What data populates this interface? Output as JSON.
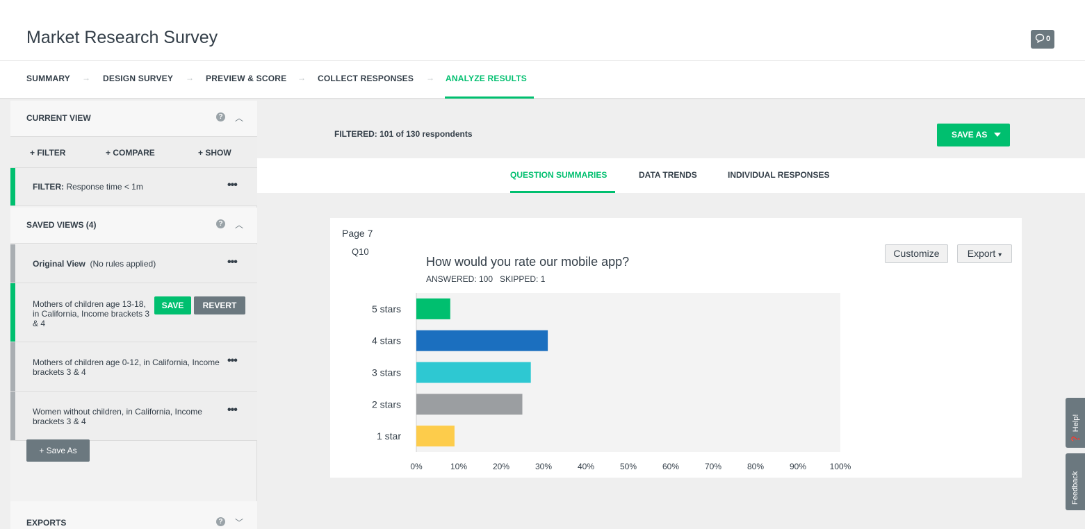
{
  "header": {
    "title": "Market Research Survey",
    "comment_count": "0"
  },
  "steps": [
    {
      "label": "SUMMARY"
    },
    {
      "label": "DESIGN SURVEY"
    },
    {
      "label": "PREVIEW & SCORE"
    },
    {
      "label": "COLLECT RESPONSES"
    },
    {
      "label": "ANALYZE RESULTS"
    }
  ],
  "sidebar": {
    "current_view": {
      "heading": "CURRENT VIEW",
      "actions": [
        "+ FILTER",
        "+ COMPARE",
        "+ SHOW"
      ],
      "filter_key": "FILTER:",
      "filter_value": "Response time < 1m"
    },
    "saved_views": {
      "heading": "SAVED VIEWS (4)",
      "original_name": "Original View",
      "original_note": "(No rules applied)",
      "views": [
        "Mothers of children age 13-18, in California, Income brackets 3 & 4",
        "Mothers of children age 0-12, in California, Income brackets 3 & 4",
        "Women without children, in California, Income brackets 3 & 4"
      ],
      "save_label": "SAVE",
      "revert_label": "REVERT",
      "save_as_label": "+ Save As"
    },
    "exports_heading": "EXPORTS"
  },
  "main": {
    "filtered_text": "FILTERED: 101 of 130 respondents",
    "save_as_label": "SAVE AS",
    "tabs": [
      "QUESTION SUMMARIES",
      "DATA TRENDS",
      "INDIVIDUAL RESPONSES"
    ],
    "question": {
      "page": "Page 7",
      "number": "Q10",
      "title": "How would you rate our mobile app?",
      "stats": "ANSWERED: 100   SKIPPED: 1",
      "customize_label": "Customize",
      "export_label": "Export"
    }
  },
  "side_tabs": {
    "help": "Help!",
    "feedback": "Feedback"
  },
  "chart_data": {
    "type": "bar",
    "orientation": "horizontal",
    "categories": [
      "5 stars",
      "4 stars",
      "3 stars",
      "2 stars",
      "1 star"
    ],
    "values": [
      8,
      31,
      27,
      25,
      9
    ],
    "colors": [
      "#00bf6f",
      "#1b6fbf",
      "#2ec8d2",
      "#9b9ea1",
      "#fdcc4b"
    ],
    "xlim": [
      0,
      100
    ],
    "x_ticks": [
      "0%",
      "10%",
      "20%",
      "30%",
      "40%",
      "50%",
      "60%",
      "70%",
      "80%",
      "90%",
      "100%"
    ],
    "grid": false
  }
}
